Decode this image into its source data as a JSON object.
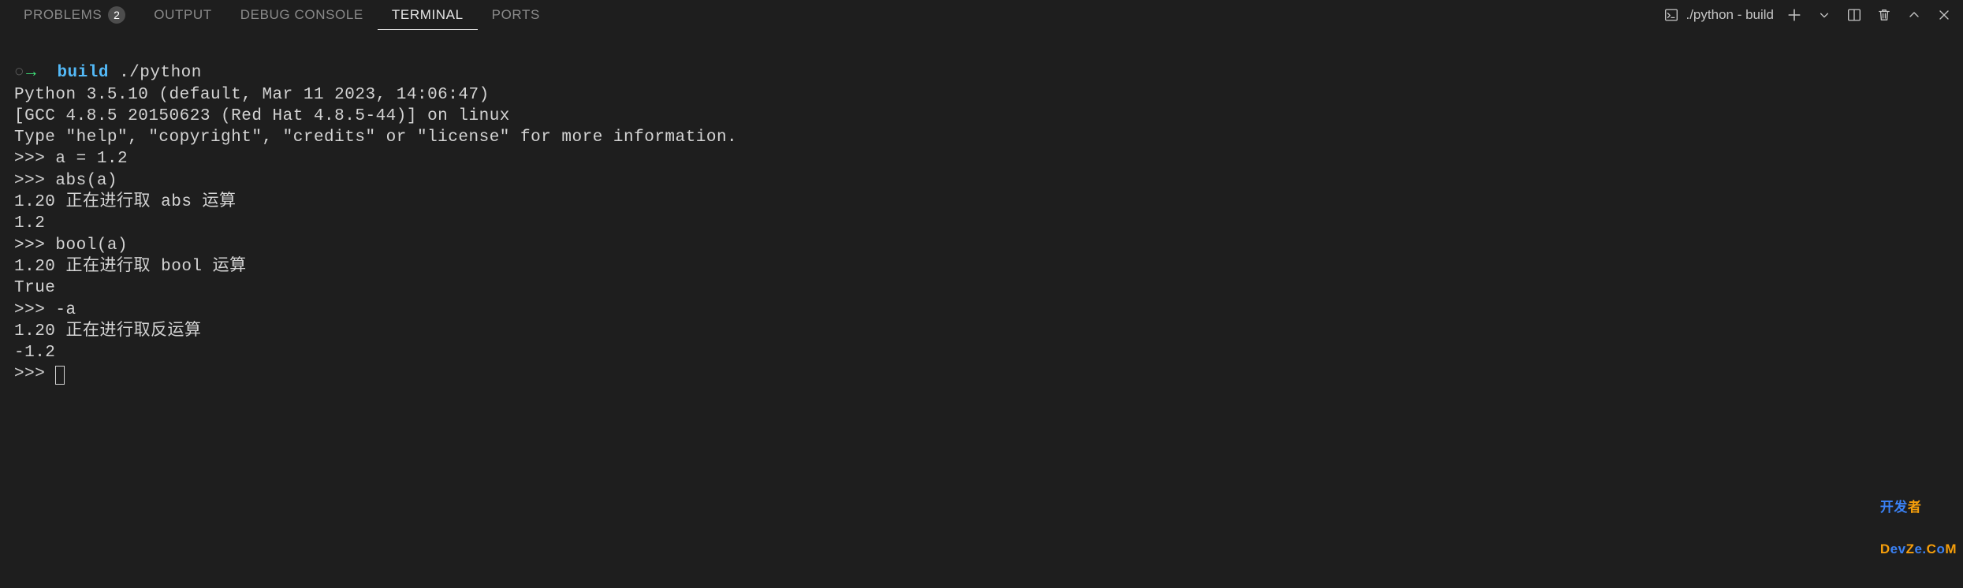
{
  "tabs": {
    "problems": "PROBLEMS",
    "problems_count": "2",
    "output": "OUTPUT",
    "debug_console": "DEBUG CONSOLE",
    "terminal": "TERMINAL",
    "ports": "PORTS"
  },
  "header": {
    "launch_label": "./python - build"
  },
  "terminal": {
    "prompt_circle": "○",
    "prompt_arrow": "→",
    "prompt_dir": "build",
    "prompt_cmd": "./python",
    "line1": "Python 3.5.10 (default, Mar 11 2023, 14:06:47) ",
    "line2": "[GCC 4.8.5 20150623 (Red Hat 4.8.5-44)] on linux",
    "line3": "Type \"help\", \"copyright\", \"credits\" or \"license\" for more information.",
    "line4": ">>> a = 1.2",
    "line5": ">>> abs(a)",
    "line6": "1.20 正在进行取 abs 运算",
    "line7": "1.2",
    "line8": ">>> bool(a)",
    "line9": "1.20 正在进行取 bool 运算",
    "line10": "True",
    "line11": ">>> -a",
    "line12": "1.20 正在进行取反运算",
    "line13": "-1.2",
    "line14": ">>> "
  },
  "watermark": {
    "line1a": "开发",
    "line1b": "者",
    "line2a": "D",
    "line2b": "ev",
    "line2c": "Z",
    "line2d": "e.",
    "line2e": "C",
    "line2f": "о",
    "line2g": "M"
  }
}
